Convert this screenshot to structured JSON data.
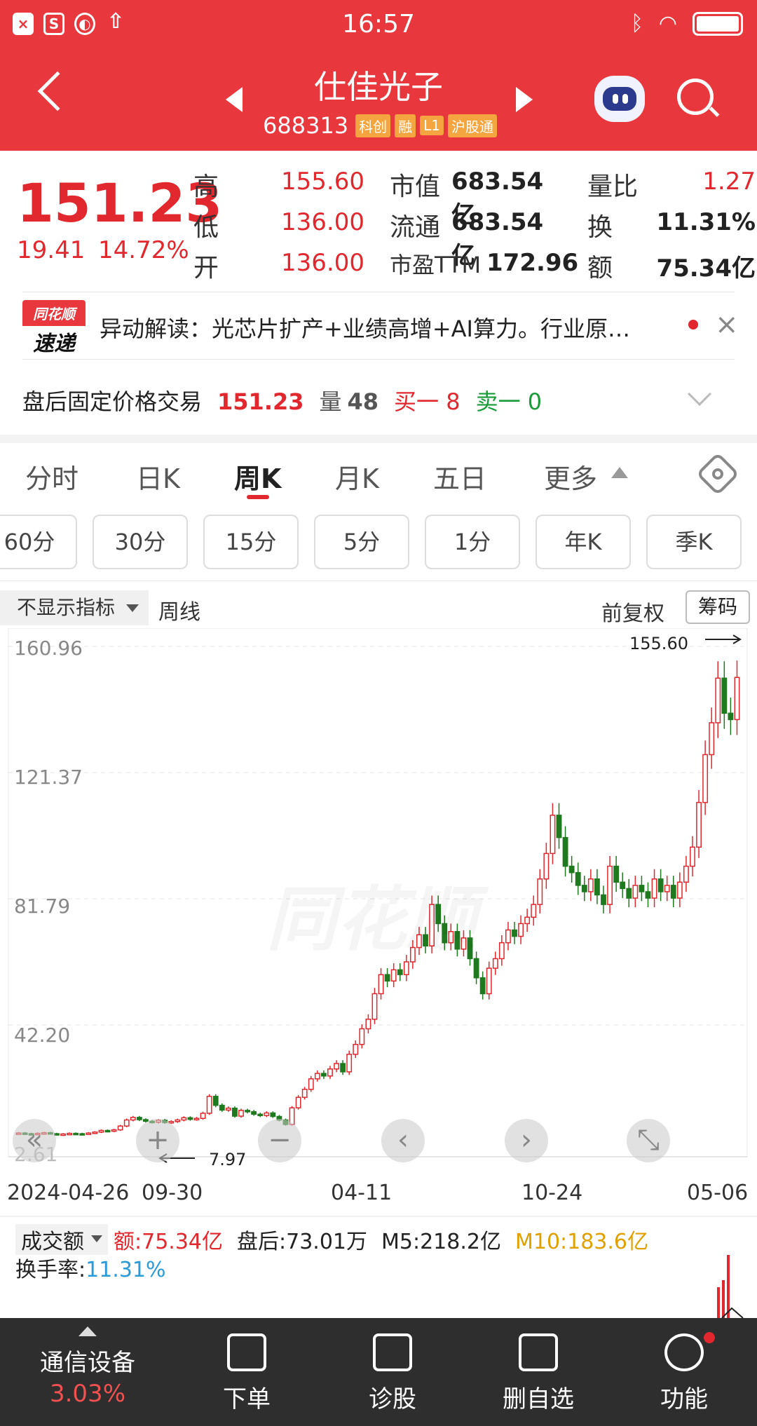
{
  "status_bar": {
    "time": "16:57"
  },
  "header": {
    "stock_name": "仕佳光子",
    "stock_code": "688313",
    "tags": [
      "科创",
      "融",
      "L1",
      "沪股通"
    ]
  },
  "quote": {
    "price": "151.23",
    "change": "19.41",
    "change_pct": "14.72%",
    "rows": [
      {
        "l1": "高",
        "v1": "155.60",
        "l2": "市值",
        "v2": "683.54亿",
        "l3": "量比",
        "v3": "1.27"
      },
      {
        "l1": "低",
        "v1": "136.00",
        "l2": "流通",
        "v2": "683.54亿",
        "l3": "换",
        "v3": "11.31%"
      },
      {
        "l1": "开",
        "v1": "136.00",
        "l2": "市盈TTM",
        "v2": "172.96",
        "l3": "额",
        "v3": "75.34亿"
      }
    ]
  },
  "news": {
    "logo_top": "同花顺",
    "logo_bottom": "速递",
    "text": "异动解读：光芯片扩产+业绩高增+AI算力。行业原…"
  },
  "after_hours": {
    "label": "盘后固定价格交易",
    "price": "151.23",
    "vol_label": "量",
    "vol": "48",
    "buy": "买一 8",
    "sell": "卖一 0"
  },
  "tabs": [
    "分时",
    "日K",
    "周K",
    "月K",
    "五日",
    "更多"
  ],
  "periods": [
    "60分",
    "30分",
    "15分",
    "5分",
    "1分",
    "年K",
    "季K"
  ],
  "indicator": {
    "select": "不显示指标",
    "name": "周线",
    "adjust": "前复权",
    "chips": "筹码"
  },
  "chart_data": {
    "type": "candlestick",
    "y_ticks": [
      "160.96",
      "121.37",
      "81.79",
      "42.20",
      "2.61"
    ],
    "x_ticks": [
      "2024-04-26",
      "09-30",
      "04-11",
      "10-24",
      "05-06"
    ],
    "high_marker": "155.60",
    "low_marker": "7.97",
    "ylim": [
      2.61,
      160.96
    ],
    "closes": [
      8.3,
      8.1,
      8.0,
      8.2,
      8.4,
      8.1,
      7.9,
      8.0,
      8.2,
      8.1,
      8.0,
      8.3,
      8.6,
      9.1,
      8.9,
      9.3,
      10.5,
      12.4,
      13.2,
      12.5,
      12.0,
      11.7,
      12.3,
      11.6,
      11.9,
      12.4,
      13.1,
      12.6,
      12.9,
      14.5,
      19.8,
      17.0,
      15.5,
      16.1,
      13.6,
      15.4,
      15.0,
      14.2,
      13.8,
      14.6,
      13.5,
      12.4,
      11.0,
      16.2,
      19.5,
      22.0,
      25.3,
      27.0,
      26.2,
      28.4,
      30.1,
      27.5,
      33.0,
      36.1,
      41.0,
      44.0,
      52.0,
      58.0,
      56.0,
      59.5,
      58.0,
      62.0,
      66.5,
      70.5,
      67.0,
      80.0,
      74.0,
      68.0,
      71.5,
      66.0,
      69.5,
      63.0,
      57.0,
      52.0,
      60.0,
      63.0,
      68.0,
      72.0,
      70.0,
      74.0,
      76.0,
      80.0,
      88.0,
      96.0,
      108.0,
      101.0,
      92.0,
      90.0,
      86.0,
      84.0,
      88.0,
      83.0,
      80.0,
      92.0,
      87.0,
      85.0,
      82.0,
      86.0,
      84.0,
      82.0,
      88.0,
      84.0,
      86.0,
      82.0,
      87.0,
      92.0,
      98.0,
      112.0,
      127.0,
      137.0,
      151.0,
      140.0,
      138.0,
      151.23
    ]
  },
  "volume": {
    "select": "成交额",
    "amount": "额:75.34亿",
    "after": "盘后:73.01万",
    "m5": "M5:218.2亿",
    "m10": "M10:183.6亿",
    "turnover_label": "换手率:",
    "turnover": "11.31%"
  },
  "bottom_nav": {
    "sector": "通信设备",
    "sector_pct": "3.03%",
    "items": [
      "下单",
      "诊股",
      "删自选",
      "功能"
    ]
  }
}
